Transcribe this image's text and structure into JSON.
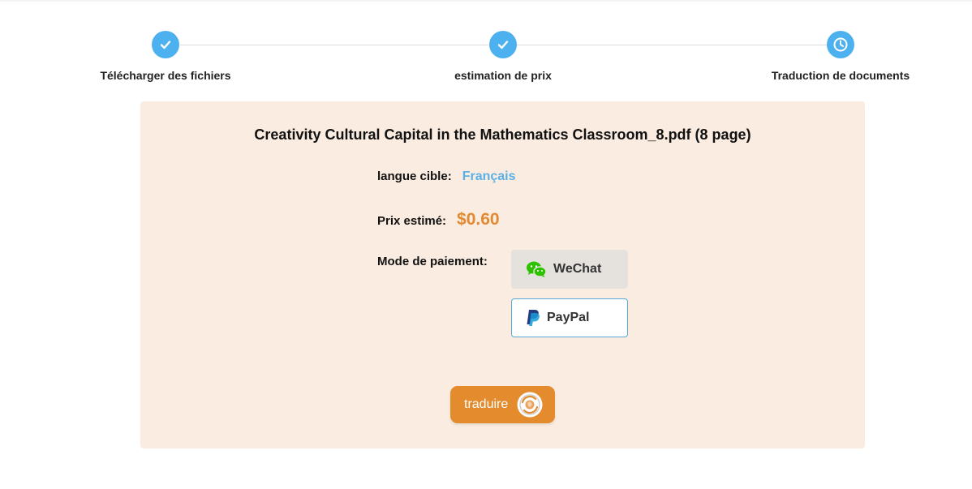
{
  "steps": [
    {
      "label": "Télécharger des fichiers",
      "status": "completed",
      "icon": "check-icon"
    },
    {
      "label": "estimation de prix",
      "status": "completed",
      "icon": "check-icon"
    },
    {
      "label": "Traduction de documents",
      "status": "current",
      "icon": "clock-icon"
    }
  ],
  "file": {
    "title": "Creativity Cultural Capital in the Mathematics Classroom_8.pdf (8 page)"
  },
  "target_language": {
    "label": "langue cible:",
    "value": "Français"
  },
  "price": {
    "label": "Prix estimé:",
    "value": "$0.60"
  },
  "payment": {
    "label": "Mode de paiement:",
    "options": [
      {
        "label": "WeChat",
        "icon": "wechat-icon",
        "selected": true
      },
      {
        "label": "PayPal",
        "icon": "paypal-icon",
        "selected": false
      }
    ]
  },
  "translate_button": {
    "label": "traduire",
    "icon": "translate-globe-icon"
  },
  "colors": {
    "step_accent": "#4db0ef",
    "card_background": "#faece0",
    "price": "#e08a33",
    "language": "#5bb1e7",
    "translate_button": "#e38b2d"
  }
}
